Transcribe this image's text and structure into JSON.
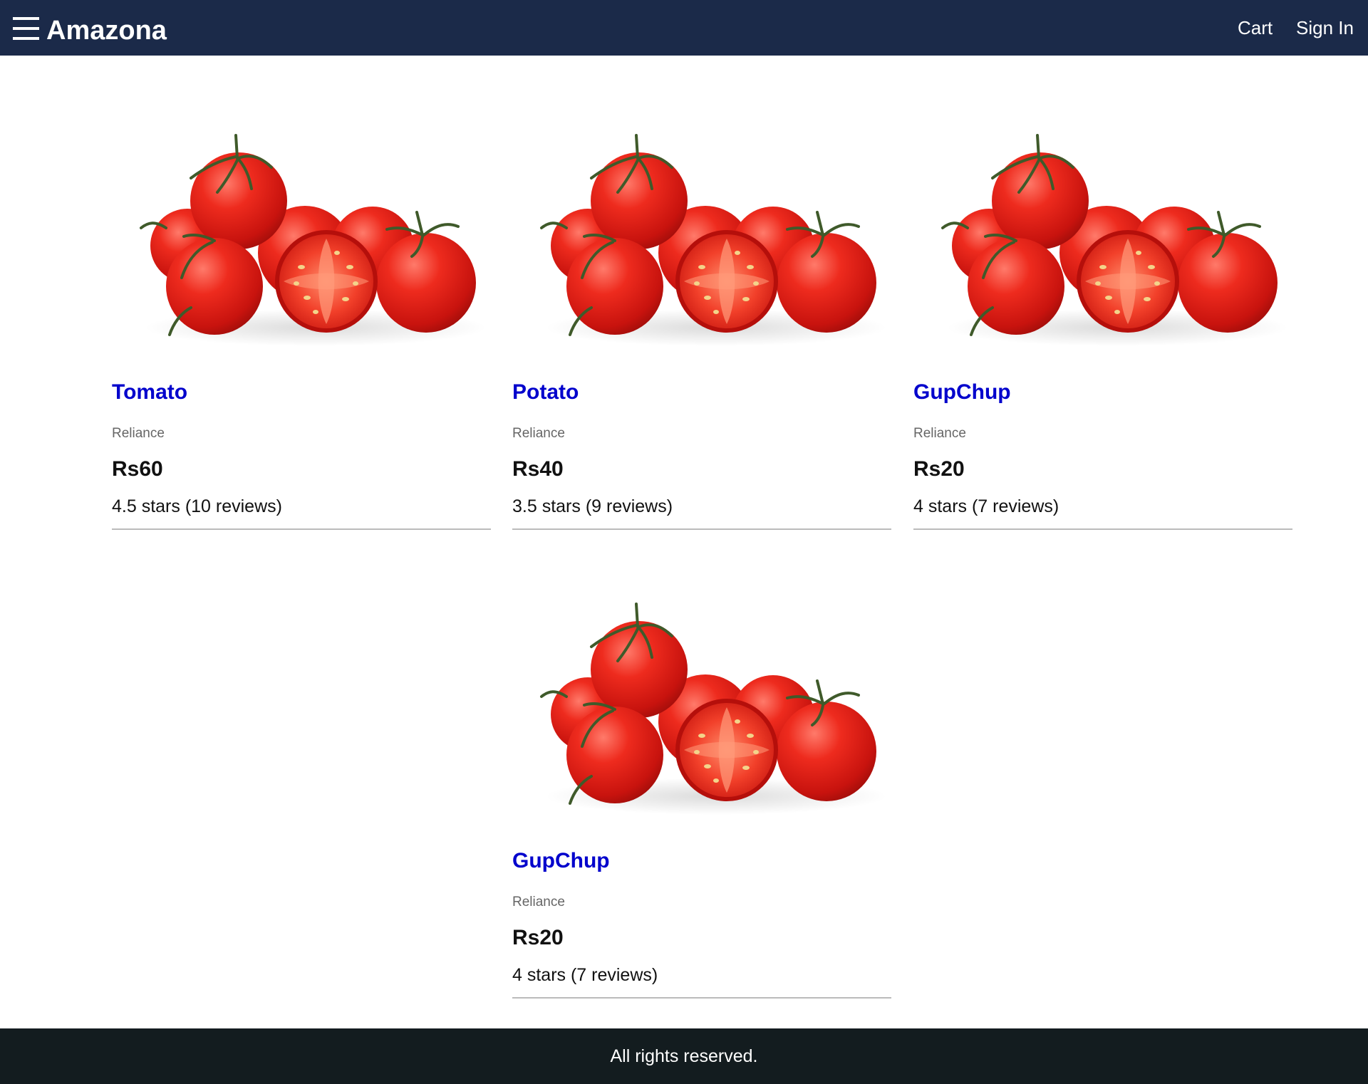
{
  "header": {
    "menu_icon": "hamburger-menu-icon",
    "brand": "Amazona",
    "cart_label": "Cart",
    "signin_label": "Sign In",
    "background_color": "#1b2a49"
  },
  "products": [
    {
      "name": "Tomato",
      "brand": "Reliance",
      "price": "Rs60",
      "rating_text": "4.5 stars (10 reviews)",
      "rating": 4.5,
      "reviews": 10
    },
    {
      "name": "Potato",
      "brand": "Reliance",
      "price": "Rs40",
      "rating_text": "3.5 stars (9 reviews)",
      "rating": 3.5,
      "reviews": 9
    },
    {
      "name": "GupChup",
      "brand": "Reliance",
      "price": "Rs20",
      "rating_text": "4 stars (7 reviews)",
      "rating": 4,
      "reviews": 7
    },
    {
      "name": "GupChup",
      "brand": "Reliance",
      "price": "Rs20",
      "rating_text": "4 stars (7 reviews)",
      "rating": 4,
      "reviews": 7
    }
  ],
  "footer": {
    "text": "All rights reserved.",
    "background_color": "#131c1f"
  },
  "colors": {
    "product_link": "#0000cc",
    "tomato_red": "#e3201d"
  }
}
